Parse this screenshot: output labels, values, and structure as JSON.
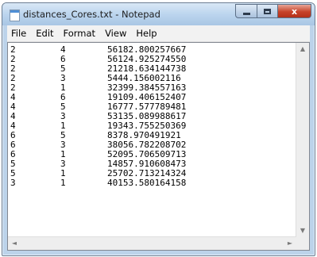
{
  "window": {
    "title": "distances_Cores.txt - Notepad",
    "icons": {
      "app": "notepad-icon",
      "minimize": "minimize-icon",
      "maximize": "maximize-icon",
      "close": "close-icon"
    },
    "close_glyph": "x",
    "colors": {
      "close_button": "#c7432a",
      "titlebar": "#bcd5ee"
    }
  },
  "menubar": {
    "items": [
      "File",
      "Edit",
      "Format",
      "View",
      "Help"
    ]
  },
  "content": {
    "lines": [
      [
        "2",
        "4",
        "56182.800257667"
      ],
      [
        "2",
        "6",
        "56124.925274550"
      ],
      [
        "2",
        "5",
        "21218.634144738"
      ],
      [
        "2",
        "3",
        "5444.156002116"
      ],
      [
        "2",
        "1",
        "32399.384557163"
      ],
      [
        "4",
        "6",
        "19109.406152407"
      ],
      [
        "4",
        "5",
        "16777.577789481"
      ],
      [
        "4",
        "3",
        "53135.089988617"
      ],
      [
        "4",
        "1",
        "19343.755250369"
      ],
      [
        "6",
        "5",
        "8378.970491921"
      ],
      [
        "6",
        "3",
        "38056.782208702"
      ],
      [
        "6",
        "1",
        "52095.706509713"
      ],
      [
        "5",
        "3",
        "14857.910608473"
      ],
      [
        "5",
        "1",
        "25702.713214324"
      ],
      [
        "3",
        "1",
        "40153.580164158"
      ]
    ]
  },
  "scrollbars": {
    "up_glyph": "▲",
    "down_glyph": "▼",
    "left_glyph": "◄",
    "right_glyph": "►"
  }
}
